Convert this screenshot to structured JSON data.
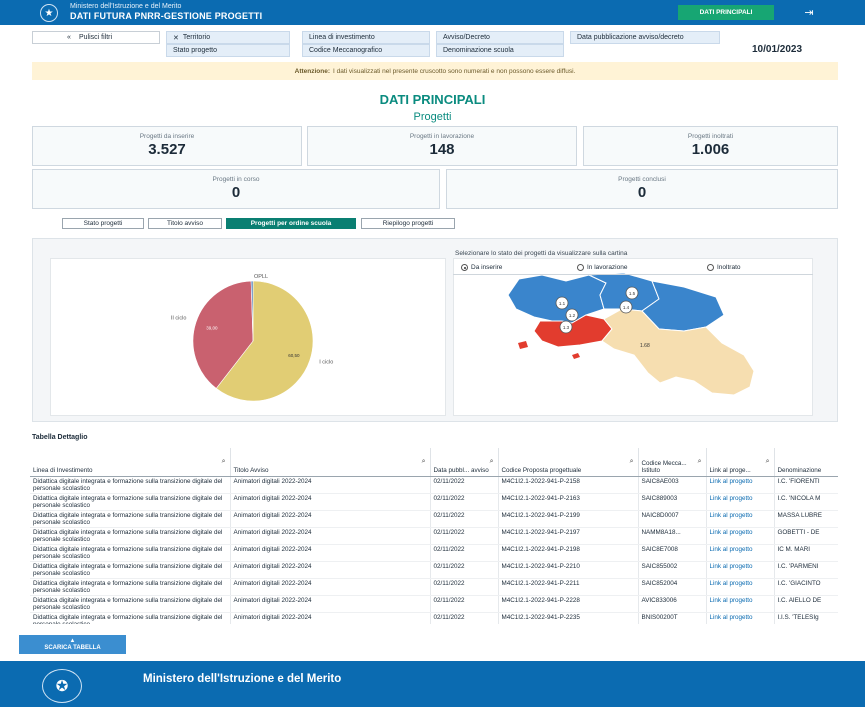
{
  "header": {
    "ministry_line": "Ministero dell'Istruzione e del Merito",
    "app_title": "DATI FUTURA PNRR-GESTIONE PROGETTI",
    "main_button": "DATI PRINCIPALI",
    "logout_icon": "logout-icon"
  },
  "filters": {
    "reset": "Pulisci filtri",
    "items": [
      "Territorio",
      "Linea di investimento",
      "Avviso/Decreto",
      "Data pubblicazione avviso/decreto",
      "Stato progetto",
      "Codice Meccanografico",
      "Denominazione scuola"
    ],
    "date": "10/01/2023"
  },
  "alert": {
    "strong": "Attenzione:",
    "text": "I dati visualizzati nel presente cruscotto sono numerati e non possono essere diffusi."
  },
  "section": {
    "title": "DATI PRINCIPALI",
    "subtitle": "Progetti"
  },
  "kpis": [
    {
      "label": "Progetti da inserire",
      "value": "3.527"
    },
    {
      "label": "Progetti in lavorazione",
      "value": "148"
    },
    {
      "label": "Progetti inoltrati",
      "value": "1.006"
    },
    {
      "label": "Progetti in corso",
      "value": "0"
    },
    {
      "label": "Progetti conclusi",
      "value": "0"
    }
  ],
  "tabs": [
    "Stato progetti",
    "Titolo avviso",
    "Progetti per ordine scuola",
    "Riepilogo progetti"
  ],
  "chart_data": {
    "type": "pie",
    "slices": [
      {
        "label": "I ciclo",
        "value": 60.5,
        "value_label": "60,50",
        "color": "#e1cd74"
      },
      {
        "label": "II ciclo",
        "value": 39.0,
        "value_label": "39,00",
        "color": "#c9616f"
      },
      {
        "label": "OPLL",
        "value": 0.5,
        "value_label": "",
        "color": "#4a79b5"
      }
    ]
  },
  "map": {
    "caption": "Selezionare lo stato dei progetti da visualizzare sulla cartina",
    "options": [
      "Da inserire",
      "In lavorazione",
      "Inoltrato"
    ],
    "selected": 0,
    "colors": {
      "high": "#3a85cc",
      "red": "#e23c2e",
      "low": "#f6deb0"
    }
  },
  "table": {
    "title": "Tabella Dettaglio",
    "columns": [
      "Linea di Investimento",
      "Titolo Avviso",
      "Data pubbl... avviso",
      "Codice Proposta progettuale",
      "Codice Mecca... Istituto",
      "Link al proge...",
      "Denominazione"
    ],
    "rows": [
      [
        "Didattica digitale integrata e formazione sulla transizione digitale del personale scolastico",
        "Animatori digitali 2022-2024",
        "02/11/2022",
        "M4C1I2.1-2022-941-P-2158",
        "SAIC8AE003",
        "Link al progetto",
        "I.C. 'FIORENTI"
      ],
      [
        "Didattica digitale integrata e formazione sulla transizione digitale del personale scolastico",
        "Animatori digitali 2022-2024",
        "02/11/2022",
        "M4C1I2.1-2022-941-P-2163",
        "SAIC889003",
        "Link al progetto",
        "I.C. 'NICOLA M"
      ],
      [
        "Didattica digitale integrata e formazione sulla transizione digitale del personale scolastico",
        "Animatori digitali 2022-2024",
        "02/11/2022",
        "M4C1I2.1-2022-941-P-2199",
        "NAIC8D0007",
        "Link al progetto",
        "MASSA LUBRE"
      ],
      [
        "Didattica digitale integrata e formazione sulla transizione digitale del personale scolastico",
        "Animatori digitali 2022-2024",
        "02/11/2022",
        "M4C1I2.1-2022-941-P-2197",
        "NAMM8A18...",
        "Link al progetto",
        "GOBETTI - DE"
      ],
      [
        "Didattica digitale integrata e formazione sulla transizione digitale del personale scolastico",
        "Animatori digitali 2022-2024",
        "02/11/2022",
        "M4C1I2.1-2022-941-P-2198",
        "SAIC8E7008",
        "Link al progetto",
        "IC M. MARI"
      ],
      [
        "Didattica digitale integrata e formazione sulla transizione digitale del personale scolastico",
        "Animatori digitali 2022-2024",
        "02/11/2022",
        "M4C1I2.1-2022-941-P-2210",
        "SAIC855002",
        "Link al progetto",
        "I.C. 'PARMENI"
      ],
      [
        "Didattica digitale integrata e formazione sulla transizione digitale del personale scolastico",
        "Animatori digitali 2022-2024",
        "02/11/2022",
        "M4C1I2.1-2022-941-P-2211",
        "SAIC852004",
        "Link al progetto",
        "I.C. 'GIACINTO"
      ],
      [
        "Didattica digitale integrata e formazione sulla transizione digitale del personale scolastico",
        "Animatori digitali 2022-2024",
        "02/11/2022",
        "M4C1I2.1-2022-941-P-2228",
        "AVIC833006",
        "Link al progetto",
        "I.C. AIELLO DE"
      ],
      [
        "Didattica digitale integrata e formazione sulla transizione digitale del personale scolastico",
        "Animatori digitali 2022-2024",
        "02/11/2022",
        "M4C1I2.1-2022-941-P-2235",
        "BNIS00200T",
        "Link al progetto",
        "I.I.S. 'TELESIg"
      ]
    ]
  },
  "download": {
    "label": "SCARICA TABELLA",
    "icon": "arrow-up-icon"
  },
  "footer": {
    "name": "Ministero dell'Istruzione e del Merito"
  }
}
